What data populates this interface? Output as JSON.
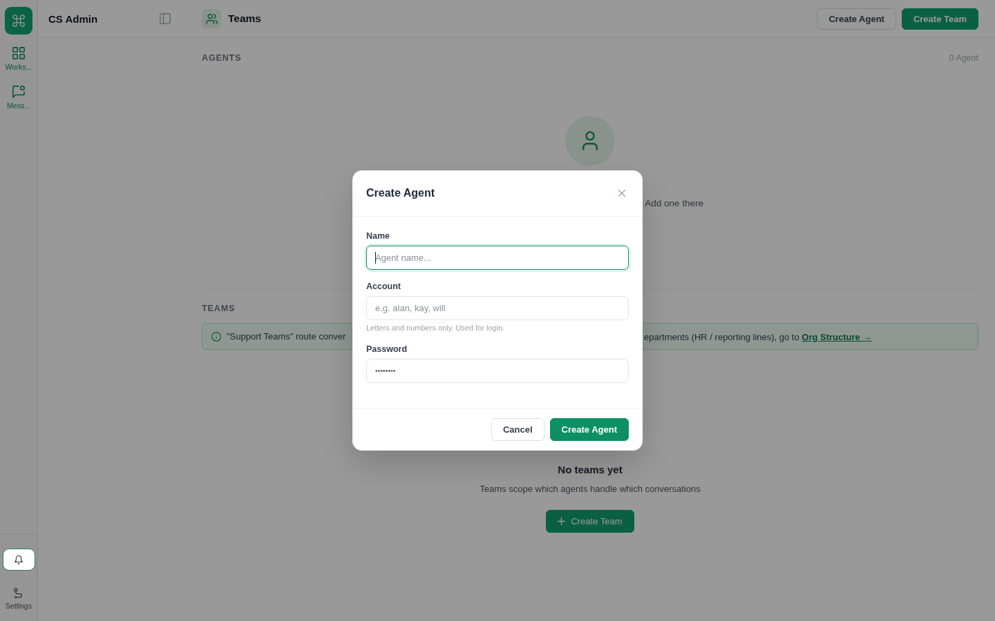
{
  "app": {
    "name": "CS Admin"
  },
  "rail": {
    "items": [
      {
        "label": "Works..."
      },
      {
        "label": "Mess..."
      }
    ],
    "settings": {
      "label": "Settings"
    }
  },
  "header": {
    "title": "Teams",
    "actions": [
      {
        "label": "Create Agent",
        "kind": "secondary"
      },
      {
        "label": "Create Team",
        "kind": "primary"
      }
    ]
  },
  "agents": {
    "heading": "AGENTS",
    "count": "0 Agent",
    "empty_text": "Add one there"
  },
  "teams": {
    "heading": "TEAMS",
    "notice": {
      "text_start": "\"Support Teams\" route conver",
      "text_end": "epartments (HR / reporting lines), go to ",
      "link": "Org Structure →"
    },
    "empty": {
      "title": "No teams yet",
      "text": "Teams scope which agents handle which conversations",
      "button": "Create Team"
    }
  },
  "dialog": {
    "title": "Create Agent",
    "fields": [
      {
        "label": "Name",
        "placeholder": "Agent name...",
        "focused": true
      },
      {
        "label": "Account",
        "placeholder": "e.g. alan, kay, will",
        "hint": "Letters and numbers only. Used for login.",
        "focused": false
      },
      {
        "label": "Password",
        "value": "••••••••",
        "focused": false
      }
    ],
    "buttons": [
      {
        "label": "Cancel",
        "kind": "secondary"
      },
      {
        "label": "Create Agent",
        "kind": "primary"
      }
    ]
  }
}
